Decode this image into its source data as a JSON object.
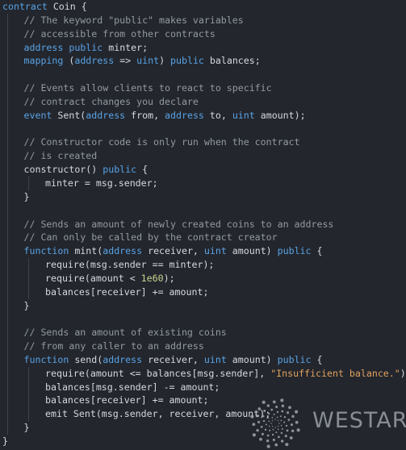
{
  "editor": {
    "language": "solidity",
    "lines": [
      {
        "indent": 0,
        "tokens": [
          {
            "t": "kw",
            "v": "contract"
          },
          {
            "t": "pl",
            "v": " Coin {"
          }
        ]
      },
      {
        "indent": 1,
        "tokens": [
          {
            "t": "cm",
            "v": "// The keyword \"public\" makes variables"
          }
        ]
      },
      {
        "indent": 1,
        "tokens": [
          {
            "t": "cm",
            "v": "// accessible from other contracts"
          }
        ]
      },
      {
        "indent": 1,
        "tokens": [
          {
            "t": "ty",
            "v": "address"
          },
          {
            "t": "pl",
            "v": " "
          },
          {
            "t": "kw",
            "v": "public"
          },
          {
            "t": "pl",
            "v": " minter;"
          }
        ]
      },
      {
        "indent": 1,
        "tokens": [
          {
            "t": "kw",
            "v": "mapping"
          },
          {
            "t": "pl",
            "v": " ("
          },
          {
            "t": "ty",
            "v": "address"
          },
          {
            "t": "pl",
            "v": " => "
          },
          {
            "t": "ty",
            "v": "uint"
          },
          {
            "t": "pl",
            "v": ") "
          },
          {
            "t": "kw",
            "v": "public"
          },
          {
            "t": "pl",
            "v": " balances;"
          }
        ]
      },
      {
        "indent": 1,
        "tokens": []
      },
      {
        "indent": 1,
        "tokens": [
          {
            "t": "cm",
            "v": "// Events allow clients to react to specific"
          }
        ]
      },
      {
        "indent": 1,
        "tokens": [
          {
            "t": "cm",
            "v": "// contract changes you declare"
          }
        ]
      },
      {
        "indent": 1,
        "tokens": [
          {
            "t": "kw",
            "v": "event"
          },
          {
            "t": "pl",
            "v": " Sent("
          },
          {
            "t": "ty",
            "v": "address"
          },
          {
            "t": "pl",
            "v": " from, "
          },
          {
            "t": "ty",
            "v": "address"
          },
          {
            "t": "pl",
            "v": " to, "
          },
          {
            "t": "ty",
            "v": "uint"
          },
          {
            "t": "pl",
            "v": " amount);"
          }
        ]
      },
      {
        "indent": 1,
        "tokens": []
      },
      {
        "indent": 1,
        "tokens": [
          {
            "t": "cm",
            "v": "// Constructor code is only run when the contract"
          }
        ]
      },
      {
        "indent": 1,
        "tokens": [
          {
            "t": "cm",
            "v": "// is created"
          }
        ]
      },
      {
        "indent": 1,
        "tokens": [
          {
            "t": "fn",
            "v": "constructor"
          },
          {
            "t": "pl",
            "v": "() "
          },
          {
            "t": "kw",
            "v": "public"
          },
          {
            "t": "pl",
            "v": " {"
          }
        ]
      },
      {
        "indent": 2,
        "tokens": [
          {
            "t": "pl",
            "v": "minter = msg.sender;"
          }
        ]
      },
      {
        "indent": 1,
        "tokens": [
          {
            "t": "pl",
            "v": "}"
          }
        ]
      },
      {
        "indent": 1,
        "tokens": []
      },
      {
        "indent": 1,
        "tokens": [
          {
            "t": "cm",
            "v": "// Sends an amount of newly created coins to an address"
          }
        ]
      },
      {
        "indent": 1,
        "tokens": [
          {
            "t": "cm",
            "v": "// Can only be called by the contract creator"
          }
        ]
      },
      {
        "indent": 1,
        "tokens": [
          {
            "t": "kw",
            "v": "function"
          },
          {
            "t": "pl",
            "v": " mint("
          },
          {
            "t": "ty",
            "v": "address"
          },
          {
            "t": "pl",
            "v": " receiver, "
          },
          {
            "t": "ty",
            "v": "uint"
          },
          {
            "t": "pl",
            "v": " amount) "
          },
          {
            "t": "kw",
            "v": "public"
          },
          {
            "t": "pl",
            "v": " {"
          }
        ]
      },
      {
        "indent": 2,
        "tokens": [
          {
            "t": "pl",
            "v": "require(msg.sender == minter);"
          }
        ]
      },
      {
        "indent": 2,
        "tokens": [
          {
            "t": "pl",
            "v": "require(amount < "
          },
          {
            "t": "nm",
            "v": "1e60"
          },
          {
            "t": "pl",
            "v": ");"
          }
        ]
      },
      {
        "indent": 2,
        "tokens": [
          {
            "t": "pl",
            "v": "balances[receiver] += amount;"
          }
        ]
      },
      {
        "indent": 1,
        "tokens": [
          {
            "t": "pl",
            "v": "}"
          }
        ]
      },
      {
        "indent": 1,
        "tokens": []
      },
      {
        "indent": 1,
        "tokens": [
          {
            "t": "cm",
            "v": "// Sends an amount of existing coins"
          }
        ]
      },
      {
        "indent": 1,
        "tokens": [
          {
            "t": "cm",
            "v": "// from any caller to an address"
          }
        ]
      },
      {
        "indent": 1,
        "tokens": [
          {
            "t": "kw",
            "v": "function"
          },
          {
            "t": "pl",
            "v": " send("
          },
          {
            "t": "ty",
            "v": "address"
          },
          {
            "t": "pl",
            "v": " receiver, "
          },
          {
            "t": "ty",
            "v": "uint"
          },
          {
            "t": "pl",
            "v": " amount) "
          },
          {
            "t": "kw",
            "v": "public"
          },
          {
            "t": "pl",
            "v": " {"
          }
        ]
      },
      {
        "indent": 2,
        "tokens": [
          {
            "t": "pl",
            "v": "require(amount <= balances[msg.sender], "
          },
          {
            "t": "st",
            "v": "\"Insufficient balance.\""
          },
          {
            "t": "pl",
            "v": ");"
          }
        ]
      },
      {
        "indent": 2,
        "tokens": [
          {
            "t": "pl",
            "v": "balances[msg.sender] -= amount;"
          }
        ]
      },
      {
        "indent": 2,
        "tokens": [
          {
            "t": "pl",
            "v": "balances[receiver] += amount;"
          }
        ]
      },
      {
        "indent": 2,
        "tokens": [
          {
            "t": "pl",
            "v": "emit Sent(msg.sender, receiver, amount);"
          }
        ]
      },
      {
        "indent": 1,
        "tokens": [
          {
            "t": "pl",
            "v": "}"
          }
        ]
      },
      {
        "indent": 0,
        "tokens": [
          {
            "t": "pl",
            "v": "}"
          }
        ]
      }
    ]
  },
  "watermark": {
    "text": "WESTAR",
    "icon": "swirl-logo-icon"
  },
  "colors": {
    "background": "#23262d",
    "keyword": "#59a3e6",
    "comment": "#939aa2",
    "plain": "#d6d9dc",
    "string": "#e0a15e",
    "number": "#c9d48f"
  }
}
